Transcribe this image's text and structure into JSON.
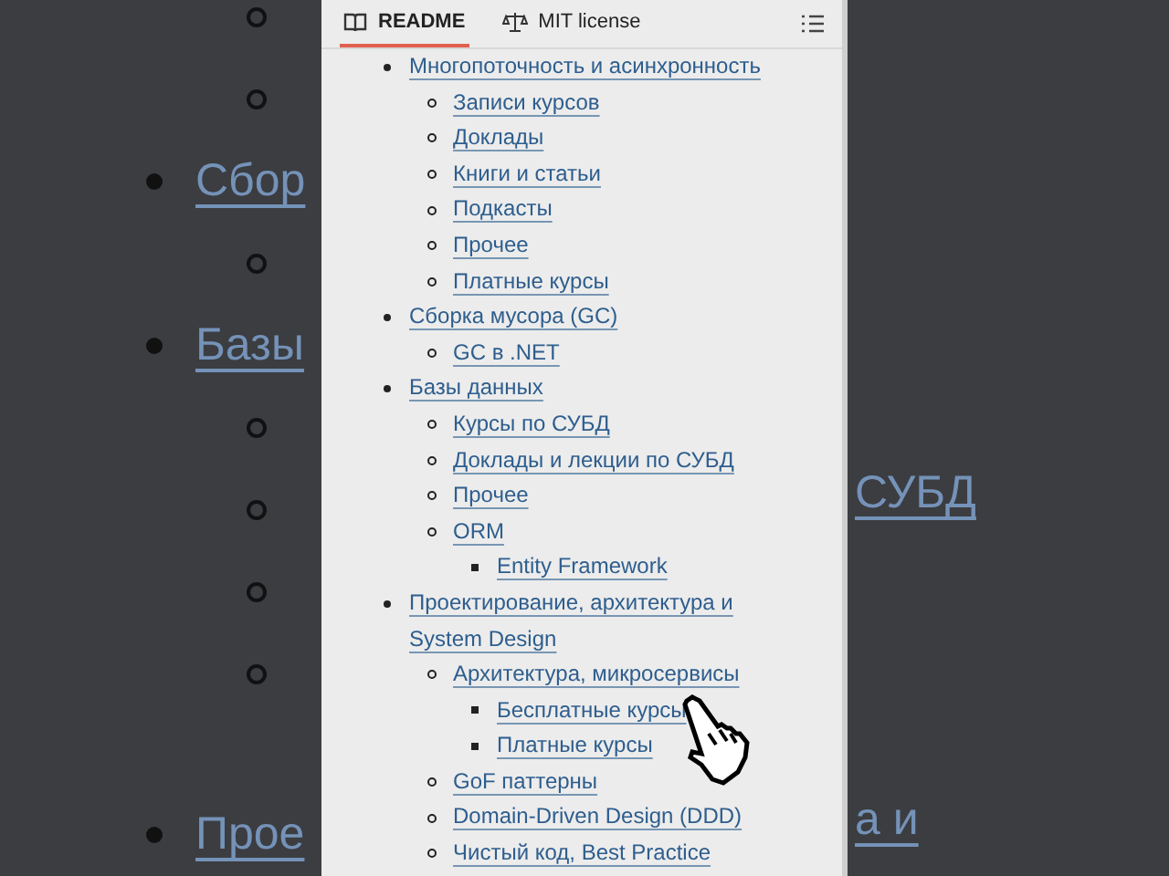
{
  "backdrop": {
    "left": [
      {
        "kind": "circle"
      },
      {
        "kind": "circle"
      },
      {
        "kind": "disc",
        "text": "Сбор"
      },
      {
        "kind": "circle"
      },
      {
        "kind": "disc",
        "text": "Базы"
      },
      {
        "kind": "circle"
      },
      {
        "kind": "circle"
      },
      {
        "kind": "circle"
      },
      {
        "kind": "circle"
      },
      {
        "kind": "disc",
        "text": "Прое"
      }
    ],
    "right": [
      "СУБД",
      "а и"
    ]
  },
  "tabs": [
    {
      "label": "README",
      "kind": "book",
      "selected": true
    },
    {
      "label": "MIT license",
      "kind": "scale",
      "selected": false
    }
  ],
  "toc": [
    {
      "text": "Многопоточность и асинхронность",
      "children": [
        {
          "text": "Записи курсов"
        },
        {
          "text": "Доклады"
        },
        {
          "text": "Книги и статьи"
        },
        {
          "text": "Подкасты"
        },
        {
          "text": "Прочее"
        },
        {
          "text": "Платные курсы"
        }
      ]
    },
    {
      "text": "Сборка мусора (GC)",
      "children": [
        {
          "text": "GC в .NET"
        }
      ]
    },
    {
      "text": "Базы данных",
      "children": [
        {
          "text": "Курсы по СУБД"
        },
        {
          "text": "Доклады и лекции по СУБД"
        },
        {
          "text": "Прочее"
        },
        {
          "text": "ORM",
          "children": [
            {
              "text": "Entity Framework"
            }
          ]
        }
      ]
    },
    {
      "text": "Проектирование, архитектура и System Design",
      "children": [
        {
          "text": "Архитектура, микросервисы",
          "children": [
            {
              "text": "Бесплатные курсы"
            },
            {
              "text": "Платные курсы"
            }
          ]
        },
        {
          "text": "GoF паттерны"
        },
        {
          "text": "Domain-Driven Design (DDD)"
        },
        {
          "text": "Чистый код, Best Practice"
        }
      ]
    }
  ]
}
